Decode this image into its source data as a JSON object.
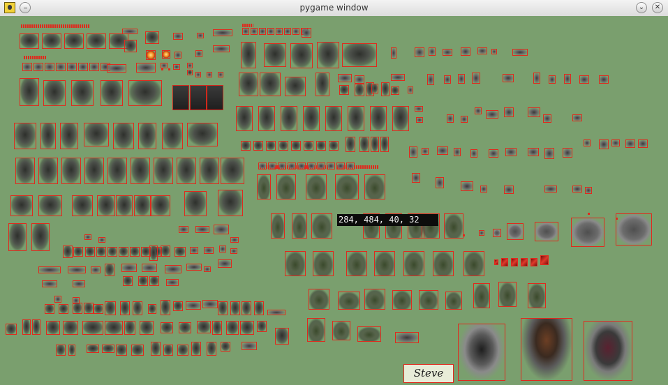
{
  "window": {
    "title": "pygame window",
    "minimize_glyph": "⌄",
    "close_glyph": "✕"
  },
  "canvas": {
    "background": "#7a9f6e",
    "outline_color": "#e0291d"
  },
  "readout": {
    "text": "284, 484, 40, 32"
  },
  "signature": {
    "text": "Steve"
  }
}
